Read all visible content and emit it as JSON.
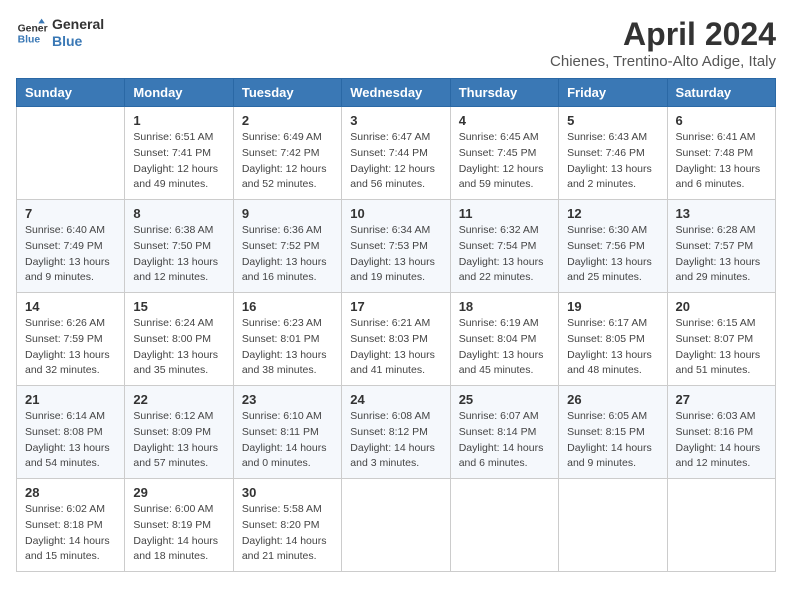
{
  "header": {
    "logo_line1": "General",
    "logo_line2": "Blue",
    "month": "April 2024",
    "location": "Chienes, Trentino-Alto Adige, Italy"
  },
  "days_of_week": [
    "Sunday",
    "Monday",
    "Tuesday",
    "Wednesday",
    "Thursday",
    "Friday",
    "Saturday"
  ],
  "weeks": [
    [
      {
        "day": "",
        "sunrise": "",
        "sunset": "",
        "daylight": ""
      },
      {
        "day": "1",
        "sunrise": "Sunrise: 6:51 AM",
        "sunset": "Sunset: 7:41 PM",
        "daylight": "Daylight: 12 hours and 49 minutes."
      },
      {
        "day": "2",
        "sunrise": "Sunrise: 6:49 AM",
        "sunset": "Sunset: 7:42 PM",
        "daylight": "Daylight: 12 hours and 52 minutes."
      },
      {
        "day": "3",
        "sunrise": "Sunrise: 6:47 AM",
        "sunset": "Sunset: 7:44 PM",
        "daylight": "Daylight: 12 hours and 56 minutes."
      },
      {
        "day": "4",
        "sunrise": "Sunrise: 6:45 AM",
        "sunset": "Sunset: 7:45 PM",
        "daylight": "Daylight: 12 hours and 59 minutes."
      },
      {
        "day": "5",
        "sunrise": "Sunrise: 6:43 AM",
        "sunset": "Sunset: 7:46 PM",
        "daylight": "Daylight: 13 hours and 2 minutes."
      },
      {
        "day": "6",
        "sunrise": "Sunrise: 6:41 AM",
        "sunset": "Sunset: 7:48 PM",
        "daylight": "Daylight: 13 hours and 6 minutes."
      }
    ],
    [
      {
        "day": "7",
        "sunrise": "Sunrise: 6:40 AM",
        "sunset": "Sunset: 7:49 PM",
        "daylight": "Daylight: 13 hours and 9 minutes."
      },
      {
        "day": "8",
        "sunrise": "Sunrise: 6:38 AM",
        "sunset": "Sunset: 7:50 PM",
        "daylight": "Daylight: 13 hours and 12 minutes."
      },
      {
        "day": "9",
        "sunrise": "Sunrise: 6:36 AM",
        "sunset": "Sunset: 7:52 PM",
        "daylight": "Daylight: 13 hours and 16 minutes."
      },
      {
        "day": "10",
        "sunrise": "Sunrise: 6:34 AM",
        "sunset": "Sunset: 7:53 PM",
        "daylight": "Daylight: 13 hours and 19 minutes."
      },
      {
        "day": "11",
        "sunrise": "Sunrise: 6:32 AM",
        "sunset": "Sunset: 7:54 PM",
        "daylight": "Daylight: 13 hours and 22 minutes."
      },
      {
        "day": "12",
        "sunrise": "Sunrise: 6:30 AM",
        "sunset": "Sunset: 7:56 PM",
        "daylight": "Daylight: 13 hours and 25 minutes."
      },
      {
        "day": "13",
        "sunrise": "Sunrise: 6:28 AM",
        "sunset": "Sunset: 7:57 PM",
        "daylight": "Daylight: 13 hours and 29 minutes."
      }
    ],
    [
      {
        "day": "14",
        "sunrise": "Sunrise: 6:26 AM",
        "sunset": "Sunset: 7:59 PM",
        "daylight": "Daylight: 13 hours and 32 minutes."
      },
      {
        "day": "15",
        "sunrise": "Sunrise: 6:24 AM",
        "sunset": "Sunset: 8:00 PM",
        "daylight": "Daylight: 13 hours and 35 minutes."
      },
      {
        "day": "16",
        "sunrise": "Sunrise: 6:23 AM",
        "sunset": "Sunset: 8:01 PM",
        "daylight": "Daylight: 13 hours and 38 minutes."
      },
      {
        "day": "17",
        "sunrise": "Sunrise: 6:21 AM",
        "sunset": "Sunset: 8:03 PM",
        "daylight": "Daylight: 13 hours and 41 minutes."
      },
      {
        "day": "18",
        "sunrise": "Sunrise: 6:19 AM",
        "sunset": "Sunset: 8:04 PM",
        "daylight": "Daylight: 13 hours and 45 minutes."
      },
      {
        "day": "19",
        "sunrise": "Sunrise: 6:17 AM",
        "sunset": "Sunset: 8:05 PM",
        "daylight": "Daylight: 13 hours and 48 minutes."
      },
      {
        "day": "20",
        "sunrise": "Sunrise: 6:15 AM",
        "sunset": "Sunset: 8:07 PM",
        "daylight": "Daylight: 13 hours and 51 minutes."
      }
    ],
    [
      {
        "day": "21",
        "sunrise": "Sunrise: 6:14 AM",
        "sunset": "Sunset: 8:08 PM",
        "daylight": "Daylight: 13 hours and 54 minutes."
      },
      {
        "day": "22",
        "sunrise": "Sunrise: 6:12 AM",
        "sunset": "Sunset: 8:09 PM",
        "daylight": "Daylight: 13 hours and 57 minutes."
      },
      {
        "day": "23",
        "sunrise": "Sunrise: 6:10 AM",
        "sunset": "Sunset: 8:11 PM",
        "daylight": "Daylight: 14 hours and 0 minutes."
      },
      {
        "day": "24",
        "sunrise": "Sunrise: 6:08 AM",
        "sunset": "Sunset: 8:12 PM",
        "daylight": "Daylight: 14 hours and 3 minutes."
      },
      {
        "day": "25",
        "sunrise": "Sunrise: 6:07 AM",
        "sunset": "Sunset: 8:14 PM",
        "daylight": "Daylight: 14 hours and 6 minutes."
      },
      {
        "day": "26",
        "sunrise": "Sunrise: 6:05 AM",
        "sunset": "Sunset: 8:15 PM",
        "daylight": "Daylight: 14 hours and 9 minutes."
      },
      {
        "day": "27",
        "sunrise": "Sunrise: 6:03 AM",
        "sunset": "Sunset: 8:16 PM",
        "daylight": "Daylight: 14 hours and 12 minutes."
      }
    ],
    [
      {
        "day": "28",
        "sunrise": "Sunrise: 6:02 AM",
        "sunset": "Sunset: 8:18 PM",
        "daylight": "Daylight: 14 hours and 15 minutes."
      },
      {
        "day": "29",
        "sunrise": "Sunrise: 6:00 AM",
        "sunset": "Sunset: 8:19 PM",
        "daylight": "Daylight: 14 hours and 18 minutes."
      },
      {
        "day": "30",
        "sunrise": "Sunrise: 5:58 AM",
        "sunset": "Sunset: 8:20 PM",
        "daylight": "Daylight: 14 hours and 21 minutes."
      },
      {
        "day": "",
        "sunrise": "",
        "sunset": "",
        "daylight": ""
      },
      {
        "day": "",
        "sunrise": "",
        "sunset": "",
        "daylight": ""
      },
      {
        "day": "",
        "sunrise": "",
        "sunset": "",
        "daylight": ""
      },
      {
        "day": "",
        "sunrise": "",
        "sunset": "",
        "daylight": ""
      }
    ]
  ]
}
